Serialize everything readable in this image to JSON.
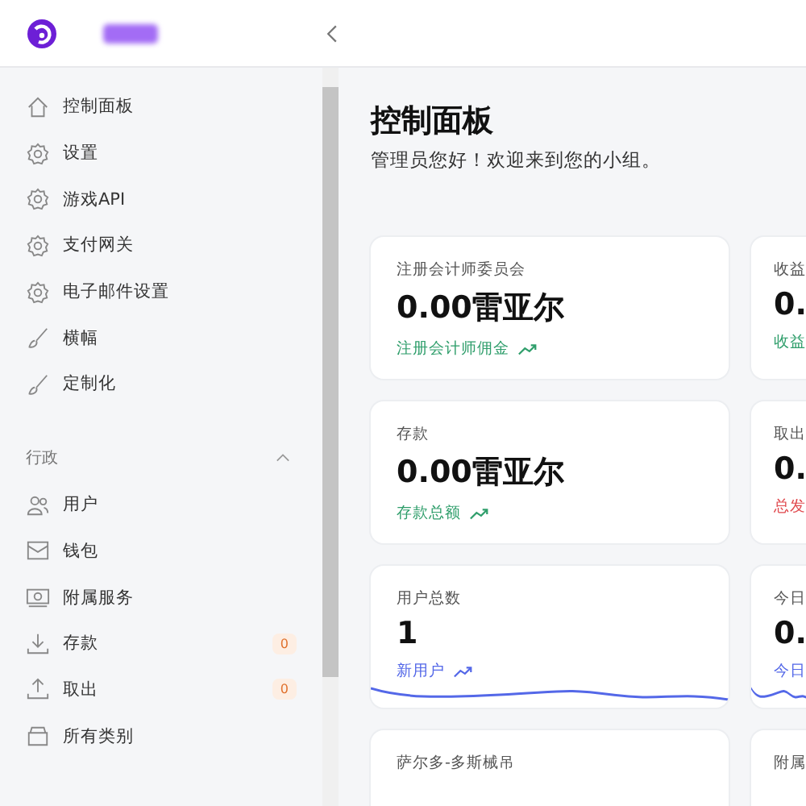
{
  "sidebar": {
    "items": [
      {
        "kind": "home",
        "label": "控制面板"
      },
      {
        "kind": "gear",
        "label": "设置"
      },
      {
        "kind": "gear",
        "label": "游戏API"
      },
      {
        "kind": "gear",
        "label": "支付网关"
      },
      {
        "kind": "gear",
        "label": "电子邮件设置"
      },
      {
        "kind": "brush",
        "label": "横幅"
      },
      {
        "kind": "brush",
        "label": "定制化"
      }
    ],
    "section": {
      "title": "行政",
      "expanded": true,
      "items": [
        {
          "kind": "users",
          "label": "用户"
        },
        {
          "kind": "envelope",
          "label": "钱包"
        },
        {
          "kind": "screen",
          "label": "附属服务"
        },
        {
          "kind": "download",
          "label": "存款",
          "badge": "0"
        },
        {
          "kind": "upload",
          "label": "取出",
          "badge": "0"
        },
        {
          "kind": "box",
          "label": "所有类别"
        }
      ]
    }
  },
  "page": {
    "title": "控制面板",
    "subtitle": "管理员您好！欢迎来到您的小组。"
  },
  "cards": [
    {
      "label": "注册会计师委员会",
      "value": "0.00雷亚尔",
      "footer": "注册会计师佣金",
      "color": "#2f9e6b"
    },
    {
      "label": "收益",
      "value": "0.",
      "footer": "收益",
      "color": "#2f9e6b"
    },
    {
      "label": "存款",
      "value": "0.00雷亚尔",
      "footer": "存款总额",
      "color": "#2f9e6b"
    },
    {
      "label": "取出",
      "value": "0.",
      "footer": "总发",
      "color": "#e0484d"
    },
    {
      "label": "用户总数",
      "value": "1",
      "footer": "新用户",
      "color": "#5468e8",
      "wave": true
    },
    {
      "label": "今日",
      "value": "0.",
      "footer": "今日",
      "color": "#5468e8",
      "wave": true
    },
    {
      "label": "萨尔多-多斯械吊"
    },
    {
      "label": "附属"
    }
  ]
}
